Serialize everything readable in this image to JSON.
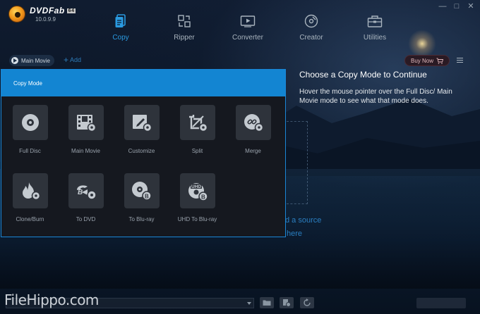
{
  "app": {
    "name": "DVDFab",
    "version_badge": "64",
    "version": "10.0.9.9"
  },
  "window_controls": [
    "—",
    "□",
    "✕"
  ],
  "nav": {
    "tabs": [
      {
        "label": "Copy",
        "icon": "copy-icon",
        "active": true
      },
      {
        "label": "Ripper",
        "icon": "ripper-icon",
        "active": false
      },
      {
        "label": "Converter",
        "icon": "converter-icon",
        "active": false
      },
      {
        "label": "Creator",
        "icon": "creator-icon",
        "active": false
      },
      {
        "label": "Utilities",
        "icon": "utilities-icon",
        "active": false
      }
    ]
  },
  "toolbar": {
    "mode_chip": "Main Movie",
    "add_label": "Add",
    "buy_now": "Buy Now"
  },
  "info": {
    "title": "Choose a Copy Mode to Continue",
    "description": "Hover the mouse pointer over the Full Disc/ Main Movie mode to see what that mode does."
  },
  "drop_zone": {
    "line1": "d a source",
    "line2": "here"
  },
  "panel": {
    "title": "Copy Mode",
    "modes": [
      {
        "label": "Full Disc",
        "icon": "disc-icon"
      },
      {
        "label": "Main Movie",
        "icon": "film-icon"
      },
      {
        "label": "Customize",
        "icon": "customize-icon"
      },
      {
        "label": "Split",
        "icon": "split-icon"
      },
      {
        "label": "Merge",
        "icon": "merge-icon"
      },
      {
        "label": "Clone/Burn",
        "icon": "flame-icon"
      },
      {
        "label": "To DVD",
        "icon": "to-dvd-icon"
      },
      {
        "label": "To Blu-ray",
        "icon": "to-bluray-icon"
      },
      {
        "label": "UHD To Blu-ray",
        "icon": "uhd-to-bluray-icon"
      }
    ]
  },
  "watermark": "FileHippo.com",
  "colors": {
    "accent": "#1385d2",
    "active_tab": "#2a9ae0",
    "panel_bg": "#15181f",
    "tile_bg": "#2e333b"
  }
}
